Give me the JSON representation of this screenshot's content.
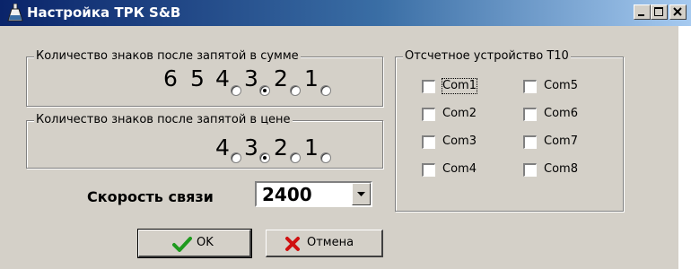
{
  "window": {
    "title": "Настройка ТРК S&B",
    "controls": [
      "minimize",
      "maximize",
      "close"
    ]
  },
  "sum_group": {
    "label": "Количество знаков после запятой в сумме",
    "options": [
      {
        "digit": "6",
        "radio": false,
        "checked": false
      },
      {
        "digit": "5",
        "radio": false,
        "checked": false
      },
      {
        "digit": "4",
        "radio": true,
        "checked": false
      },
      {
        "digit": "3",
        "radio": true,
        "checked": true
      },
      {
        "digit": "2",
        "radio": true,
        "checked": false
      },
      {
        "digit": "1",
        "radio": true,
        "checked": false
      }
    ]
  },
  "price_group": {
    "label": "Количество знаков после запятой в цене",
    "options": [
      {
        "digit": "4",
        "checked": false
      },
      {
        "digit": "3",
        "checked": true
      },
      {
        "digit": "2",
        "checked": false
      },
      {
        "digit": "1",
        "checked": false
      }
    ]
  },
  "device_group": {
    "label": "Отсчетное устройство Т10",
    "ports": [
      {
        "label": "Com1",
        "checked": false,
        "focused": true
      },
      {
        "label": "Com2",
        "checked": false,
        "focused": false
      },
      {
        "label": "Com3",
        "checked": false,
        "focused": false
      },
      {
        "label": "Com4",
        "checked": false,
        "focused": false
      },
      {
        "label": "Com5",
        "checked": false,
        "focused": false
      },
      {
        "label": "Com6",
        "checked": false,
        "focused": false
      },
      {
        "label": "Com7",
        "checked": false,
        "focused": false
      },
      {
        "label": "Com8",
        "checked": false,
        "focused": false
      }
    ]
  },
  "speed": {
    "label": "Скорость связи",
    "value": "2400"
  },
  "buttons": {
    "ok_label": "OK",
    "cancel_label": "Отмена"
  },
  "colors": {
    "face": "#d4d0c8",
    "title_start": "#0a246a",
    "title_end": "#a6caf0",
    "ok_check": "#1e9a1e",
    "cancel_x": "#d01010"
  }
}
